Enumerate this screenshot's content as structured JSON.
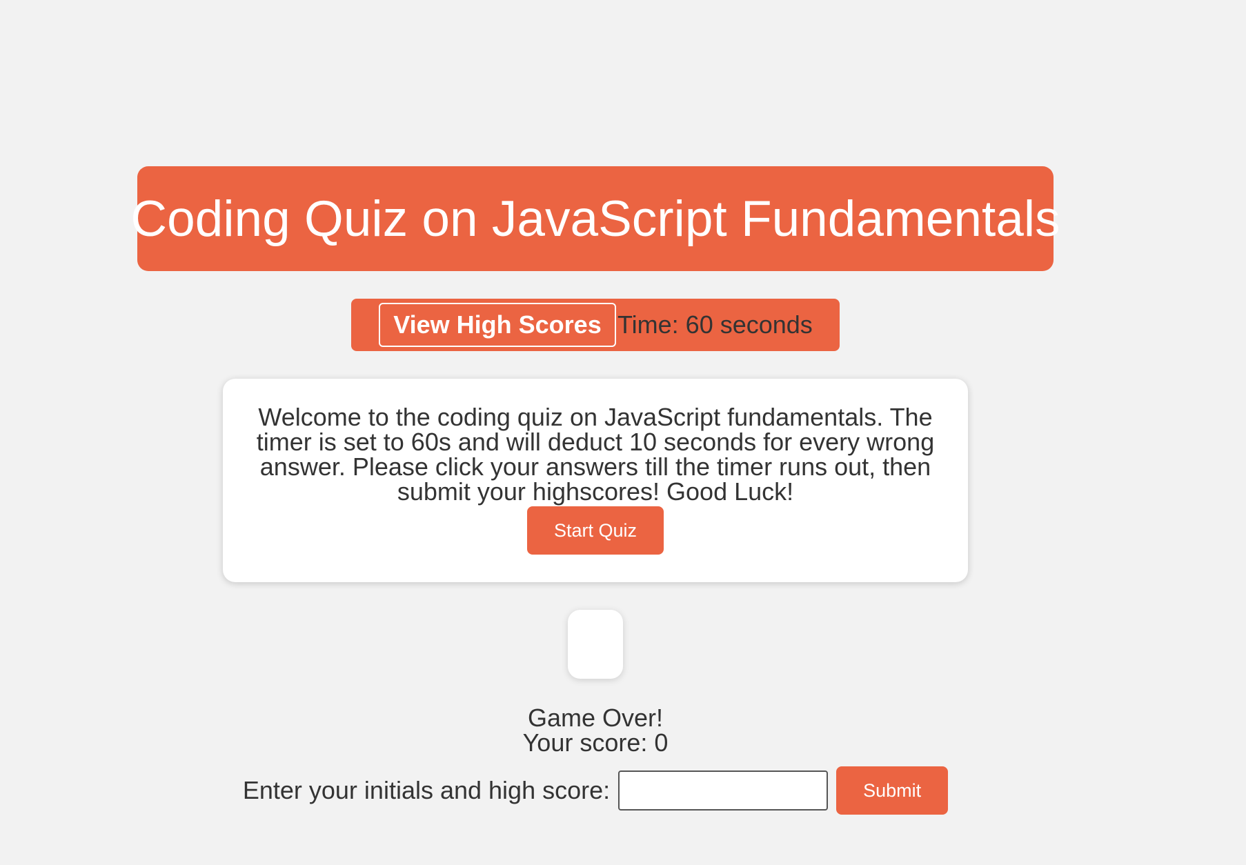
{
  "header": {
    "title": "Coding Quiz on JavaScript Fundamentals"
  },
  "nav": {
    "high_scores_label": "View High Scores",
    "timer_text": "Time: 60 seconds"
  },
  "welcome": {
    "message": "Welcome to the coding quiz on JavaScript fundamentals. The timer is set to 60s and will deduct 10 seconds for every wrong answer. Please click your answers till the timer runs out, then submit your highscores! Good Luck!",
    "start_label": "Start Quiz"
  },
  "results": {
    "game_over": "Game Over!",
    "score_text": "Your score: 0"
  },
  "score_form": {
    "label": "Enter your initials and high score:",
    "input_value": "",
    "submit_label": "Submit"
  },
  "colors": {
    "accent": "#eb6442",
    "background": "#f2f2f2",
    "card": "#ffffff",
    "text": "#333333"
  }
}
